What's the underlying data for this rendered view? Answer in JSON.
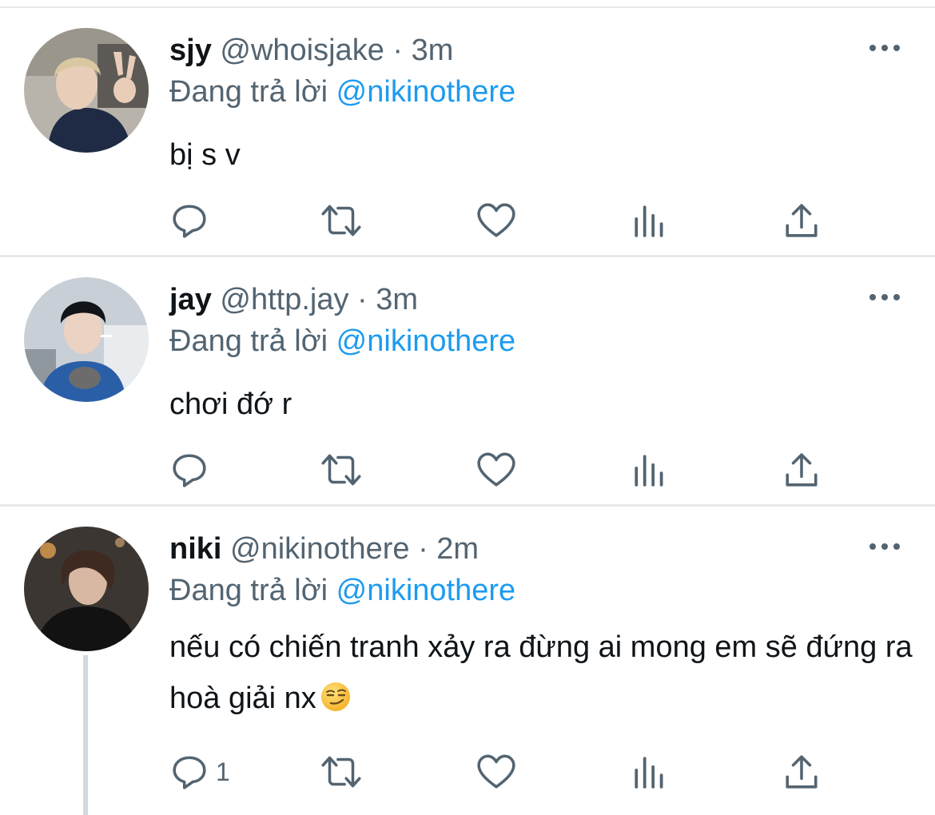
{
  "tweets": [
    {
      "name": "sjy",
      "handle": "@whoisjake",
      "separator": "·",
      "time": "3m",
      "reply_prefix": "Đang trả lời",
      "reply_to": "@nikinothere",
      "text": "bị s v",
      "reply_count": ""
    },
    {
      "name": "jay",
      "handle": "@http.jay",
      "separator": "·",
      "time": "3m",
      "reply_prefix": "Đang trả lời",
      "reply_to": "@nikinothere",
      "text": "chơi đớ r",
      "reply_count": ""
    },
    {
      "name": "niki",
      "handle": "@nikinothere",
      "separator": "·",
      "time": "2m",
      "reply_prefix": "Đang trả lời",
      "reply_to": "@nikinothere",
      "text": "nếu có chiến tranh xảy ra đừng ai mong em sẽ đứng ra hoà giải nx",
      "emoji": "smirking-face-emoji",
      "reply_count": "1"
    }
  ],
  "icons": {
    "more": "more-horizontal-icon",
    "reply": "reply-bubble-icon",
    "retweet": "retweet-icon",
    "like": "heart-icon",
    "views": "views-bar-chart-icon",
    "share": "share-upload-icon"
  },
  "colors": {
    "text": "#0f1419",
    "secondary": "#536471",
    "mention": "#1d9bf0",
    "divider": "#e6e9eb",
    "thread_line": "#cfd9de"
  }
}
